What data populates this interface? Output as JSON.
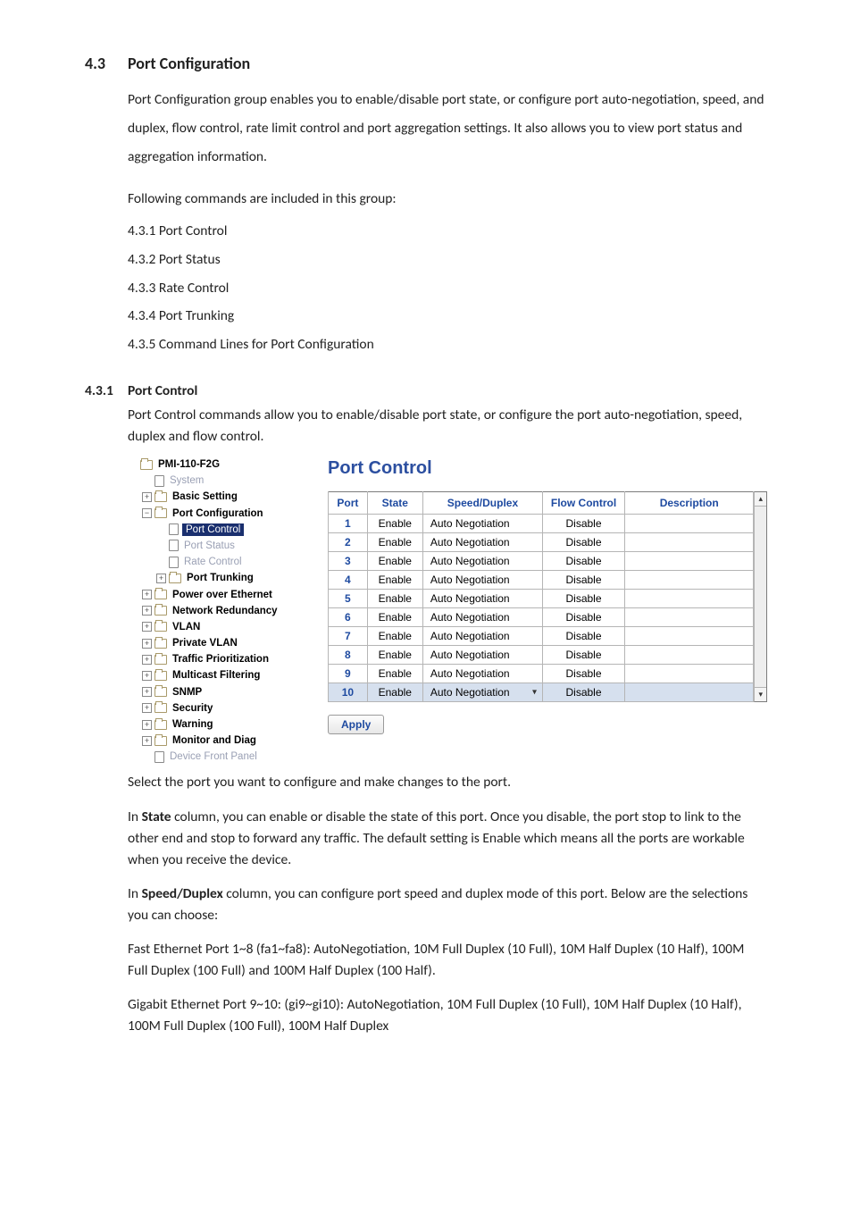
{
  "section": {
    "number": "4.3",
    "title": "Port Configuration",
    "intro": "Port Configuration group enables you to enable/disable port state, or configure port auto-negotiation, speed, and duplex, flow control, rate limit control and port aggregation settings. It also allows you to view port status and aggregation information.",
    "following": "Following commands are included in this group:",
    "items": {
      "a": "4.3.1 Port Control",
      "b": "4.3.2 Port Status",
      "c": "4.3.3 Rate Control",
      "d": "4.3.4 Port Trunking",
      "e": "4.3.5 Command Lines for Port Configuration"
    }
  },
  "subsection": {
    "number": "4.3.1",
    "title": "Port Control",
    "intro": "Port Control commands allow you to enable/disable port state, or configure the port auto-negotiation, speed, duplex and flow control."
  },
  "tree": {
    "root": "PMI-110-F2G",
    "system": "System",
    "basic": "Basic Setting",
    "portconf": "Port Configuration",
    "portcontrol": "Port Control",
    "portstatus": "Port Status",
    "ratecontrol": "Rate Control",
    "porttrunk": "Port Trunking",
    "poe": "Power over Ethernet",
    "netred": "Network Redundancy",
    "vlan": "VLAN",
    "pvlan": "Private VLAN",
    "traffic": "Traffic Prioritization",
    "mcast": "Multicast Filtering",
    "snmp": "SNMP",
    "security": "Security",
    "warning": "Warning",
    "monitor": "Monitor and Diag",
    "devfront": "Device Front Panel"
  },
  "panel": {
    "title": "Port Control",
    "headers": {
      "port": "Port",
      "state": "State",
      "sd": "Speed/Duplex",
      "fc": "Flow Control",
      "desc": "Description"
    },
    "rows": [
      {
        "port": "1",
        "state": "Enable",
        "sd": "Auto Negotiation",
        "fc": "Disable",
        "desc": ""
      },
      {
        "port": "2",
        "state": "Enable",
        "sd": "Auto Negotiation",
        "fc": "Disable",
        "desc": ""
      },
      {
        "port": "3",
        "state": "Enable",
        "sd": "Auto Negotiation",
        "fc": "Disable",
        "desc": ""
      },
      {
        "port": "4",
        "state": "Enable",
        "sd": "Auto Negotiation",
        "fc": "Disable",
        "desc": ""
      },
      {
        "port": "5",
        "state": "Enable",
        "sd": "Auto Negotiation",
        "fc": "Disable",
        "desc": ""
      },
      {
        "port": "6",
        "state": "Enable",
        "sd": "Auto Negotiation",
        "fc": "Disable",
        "desc": ""
      },
      {
        "port": "7",
        "state": "Enable",
        "sd": "Auto Negotiation",
        "fc": "Disable",
        "desc": ""
      },
      {
        "port": "8",
        "state": "Enable",
        "sd": "Auto Negotiation",
        "fc": "Disable",
        "desc": ""
      },
      {
        "port": "9",
        "state": "Enable",
        "sd": "Auto Negotiation",
        "fc": "Disable",
        "desc": ""
      },
      {
        "port": "10",
        "state": "Enable",
        "sd": "Auto Negotiation",
        "fc": "Disable",
        "desc": ""
      }
    ],
    "selected_index": 9,
    "apply": "Apply"
  },
  "after": {
    "p1": "Select the port you want to configure and make changes to the port.",
    "p2a": "In ",
    "p2b": "State",
    "p2c": " column, you can enable or disable the state of this port. Once you disable, the port stop to link to the other end and stop to forward any traffic. The default setting is Enable which means all the ports are workable when you receive the device.",
    "p3a": "In ",
    "p3b": "Speed/Duplex",
    "p3c": " column, you can configure port speed and duplex mode of this port. Below are the selections you can choose:",
    "p4": "Fast Ethernet Port 1~8 (fa1~fa8): AutoNegotiation, 10M Full Duplex (10 Full), 10M Half Duplex (10 Half), 100M Full Duplex (100 Full) and 100M Half Duplex (100 Half).",
    "p5": "Gigabit Ethernet Port 9~10: (gi9~gi10): AutoNegotiation, 10M Full Duplex (10 Full), 10M Half Duplex (10 Half), 100M Full Duplex (100 Full), 100M Half Duplex"
  }
}
